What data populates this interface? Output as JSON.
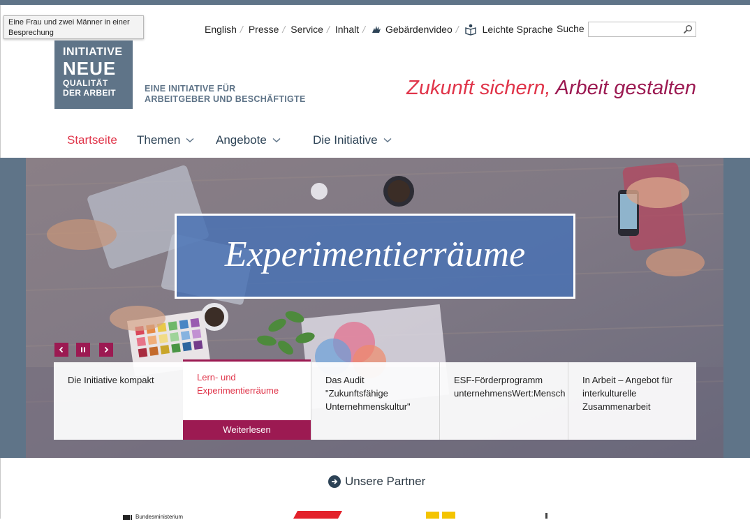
{
  "tooltip": "Eine Frau und zwei Männer in einer Besprechung",
  "service_nav": {
    "english": "English",
    "presse": "Presse",
    "service": "Service",
    "inhalt": "Inhalt",
    "gebaerden": "Gebärdenvideo",
    "leichte": "Leichte Sprache",
    "search_label": "Suche",
    "search_value": ""
  },
  "logo": {
    "line1": "INITIATIVE",
    "line2": "NEUE",
    "line3": "QUALITÄT",
    "line4": "DER ARBEIT"
  },
  "tagline": {
    "line1": "EINE INITIATIVE FÜR",
    "line2": "ARBEITGEBER UND BESCHÄFTIGTE"
  },
  "claim": {
    "part1": "Zukunft sichern,",
    "part2": " Arbeit gestalten"
  },
  "main_nav": {
    "home": "Startseite",
    "themen": "Themen",
    "angebote": "Angebote",
    "initiative": "Die Initiative"
  },
  "hero": {
    "title": "Experimentierräume"
  },
  "teasers": [
    "Die Initiative kompakt",
    "Lern- und Experimentierräume",
    "Das Audit \"Zukunftsfähige Unternehmenskultur\"",
    "ESF-Förderprogramm unternehmensWert:Mensch",
    "In Arbeit – Angebot für interkulturelle Zusammenarbeit"
  ],
  "weiterlesen": "Weiterlesen",
  "partner_heading": "Unsere Partner",
  "partner_logo_text": "Bundesministerium",
  "colors": {
    "slate": "#5f7488",
    "red": "#e0354a",
    "berry": "#9c1a52",
    "navy": "#2d4356"
  }
}
